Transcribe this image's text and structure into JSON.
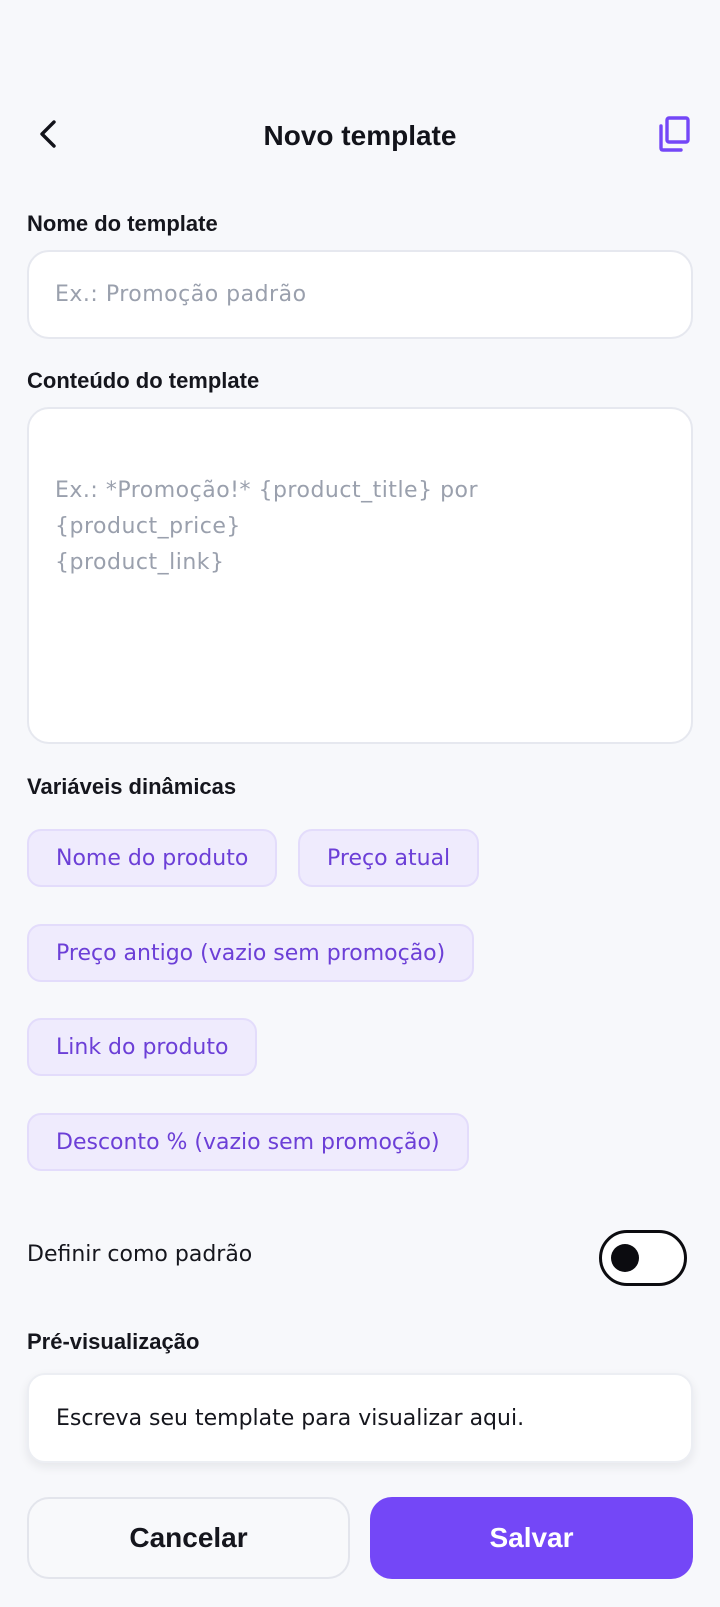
{
  "header": {
    "title": "Novo template",
    "back_icon": "chevron-left-icon",
    "copy_icon": "copy-icon"
  },
  "form": {
    "name": {
      "label": "Nome do template",
      "placeholder": "Ex.: Promoção padrão",
      "value": ""
    },
    "content": {
      "label": "Conteúdo do template",
      "placeholder": "Ex.: *Promoção!* {product_title} por\n{product_price}\n{product_link}",
      "value": ""
    }
  },
  "variables": {
    "label": "Variáveis dinâmicas",
    "chips": [
      "Nome do produto",
      "Preço atual",
      "Preço antigo (vazio sem promoção)",
      "Link do produto",
      "Desconto % (vazio sem promoção)"
    ]
  },
  "default_setting": {
    "label": "Definir como padrão",
    "enabled": false
  },
  "preview": {
    "label": "Pré-visualização",
    "text": "Escreva seu template para visualizar aqui."
  },
  "actions": {
    "cancel_label": "Cancelar",
    "save_label": "Salvar"
  },
  "colors": {
    "accent": "#7447f7",
    "chip_text": "#6c3fd7",
    "chip_background": "#efebfd",
    "background": "#f7f8fb"
  }
}
